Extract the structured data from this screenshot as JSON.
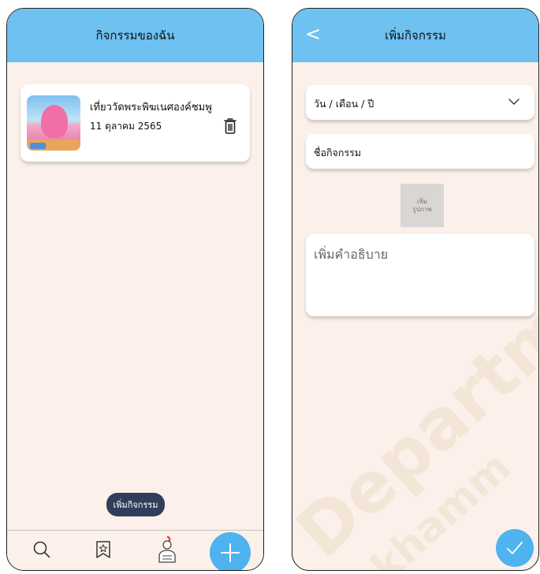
{
  "left_screen": {
    "header": {
      "title": "กิจกรรมของฉัน"
    },
    "activity_card": {
      "title": "เที่ยววัดพระพิฆเนศองค์ชมพู",
      "date": "11 ตุลาคม 2565"
    },
    "toast": {
      "label": "เพิ่มกิจกรรม"
    },
    "bottom_nav": {
      "items": [
        {
          "icon": "search-icon"
        },
        {
          "icon": "bookmark-star-icon"
        },
        {
          "icon": "user-profile-icon"
        },
        {
          "icon": "plus-icon"
        }
      ]
    }
  },
  "right_screen": {
    "header": {
      "title": "เพิ่มกิจกรรม",
      "back_label": "<"
    },
    "date_select": {
      "value": "วัน / เดือน / ปี"
    },
    "name_field": {
      "placeholder": "ชื่อกิจกรรม"
    },
    "image_button": {
      "line1": "เพิ่ม",
      "line2": "รูปภาพ"
    },
    "description": {
      "placeholder": "เพิ่มคำอธิบาย"
    },
    "watermark": "Department ... khamm"
  },
  "colors": {
    "header": "#6ec1f1",
    "background": "#fbf1ea",
    "accent": "#4fb3f0",
    "toast": "#2f3f5b"
  }
}
